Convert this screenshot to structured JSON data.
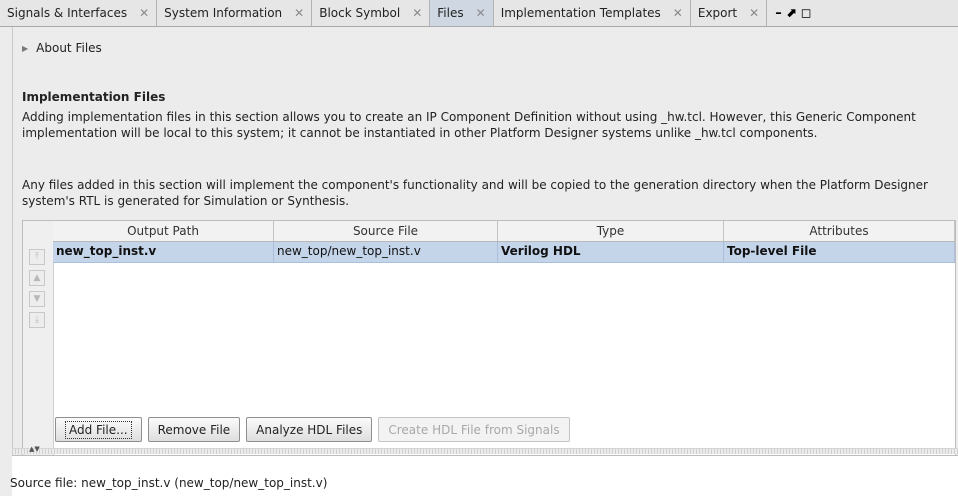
{
  "tabs": [
    {
      "label": "Signals & Interfaces",
      "close": "✕",
      "active": false
    },
    {
      "label": "System Information",
      "close": "✕",
      "active": false
    },
    {
      "label": "Block Symbol",
      "close": "✕",
      "active": false
    },
    {
      "label": "Files",
      "close": "✕",
      "active": true
    },
    {
      "label": "Implementation Templates",
      "close": "✕",
      "active": false
    },
    {
      "label": "Export",
      "close": "✕",
      "active": false
    }
  ],
  "window_controls": {
    "minimize": "–",
    "maximize": "⬈",
    "restore": "◻"
  },
  "about": {
    "label": "About Files"
  },
  "section": {
    "title": "Implementation Files",
    "para1": "Adding implementation files in this section allows you to create an IP Component Definition without using _hw.tcl. However, this Generic Component implementation will be local to this system; it cannot be instantiated in other Platform Designer systems unlike _hw.tcl components.",
    "para2": "Any files added in this section will implement the component's functionality and will be copied to the generation directory when the Platform Designer system's RTL is generated for Simulation or Synthesis."
  },
  "table": {
    "columns": [
      "Output Path",
      "Source File",
      "Type",
      "Attributes"
    ],
    "rows": [
      {
        "output_path": "new_top_inst.v",
        "source_file": "new_top/new_top_inst.v",
        "type": "Verilog HDL",
        "attributes": "Top-level File"
      }
    ]
  },
  "buttons": {
    "add": "Add File...",
    "remove": "Remove File",
    "analyze": "Analyze HDL Files",
    "create": "Create HDL File from Signals"
  },
  "status": {
    "message": "Source file: new_top_inst.v (new_top/new_top_inst.v)"
  }
}
